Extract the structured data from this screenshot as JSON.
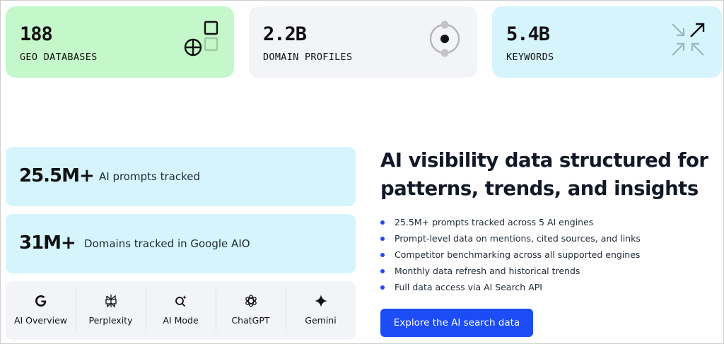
{
  "stats": [
    {
      "value": "188",
      "label": "GEO DATABASES",
      "icon": "geo-grid-icon"
    },
    {
      "value": "2.2B",
      "label": "DOMAIN PROFILES",
      "icon": "domain-orbit-icon"
    },
    {
      "value": "5.4B",
      "label": "KEYWORDS",
      "icon": "keyword-arrows-icon"
    }
  ],
  "metrics": [
    {
      "value": "25.5M+",
      "label": "AI prompts tracked"
    },
    {
      "value": "31M+",
      "label": "Domains tracked in Google AIO"
    }
  ],
  "engines": [
    {
      "label": "AI Overview",
      "icon": "google-icon"
    },
    {
      "label": "Perplexity",
      "icon": "perplexity-icon"
    },
    {
      "label": "AI Mode",
      "icon": "ai-mode-search-icon"
    },
    {
      "label": "ChatGPT",
      "icon": "chatgpt-icon"
    },
    {
      "label": "Gemini",
      "icon": "gemini-sparkle-icon"
    }
  ],
  "headline": "AI visibility data structured for patterns, trends, and insights",
  "features": [
    "25.5M+ prompts tracked across 5 AI engines",
    "Prompt-level data on mentions, cited sources, and links",
    "Competitor benchmarking across all supported engines",
    "Monthly data refresh and historical trends",
    "Full data access via AI Search API"
  ],
  "cta": {
    "label": "Explore the AI search data"
  },
  "colors": {
    "geo_card": "#c4f7c9",
    "domain_card": "#f2f4f8",
    "keyword_card": "#d6f4fc",
    "accent": "#1b4cf6"
  }
}
